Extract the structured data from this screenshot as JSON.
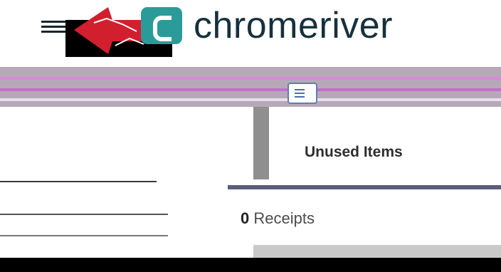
{
  "header": {
    "brand_name": "chromeriver",
    "menu_icon": "hamburger-icon",
    "logo_icon": "chromeriver-logo-icon",
    "overlay_icon": "red-arrow-icon",
    "brand_color": "#2b9b9a",
    "text_color": "#17303d",
    "arrow_color": "#d21f2e"
  },
  "unused": {
    "title": "Unused Items",
    "receipts_count": "0",
    "receipts_label": "Receipts"
  },
  "toolbar": {
    "list_icon": "list-view-icon"
  }
}
